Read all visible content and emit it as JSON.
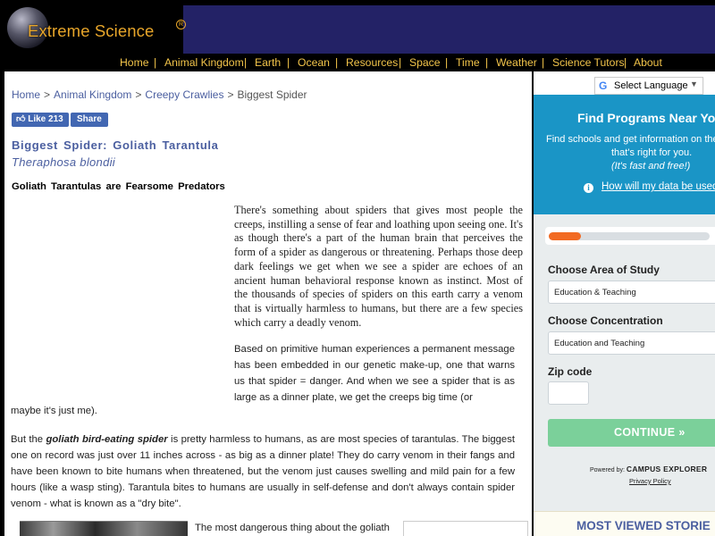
{
  "site": {
    "logo_text": "Extreme Science",
    "logo_mark": "R"
  },
  "nav": [
    "Home",
    "Animal Kingdom",
    "Earth",
    "Ocean",
    "Resources",
    "Space",
    "Time",
    "Weather",
    "Science Tutors",
    "About"
  ],
  "breadcrumb": {
    "items": [
      "Home",
      "Animal Kingdom",
      "Creepy Crawlies",
      "Biggest Spider"
    ],
    "separator": ">"
  },
  "social": {
    "like_label": "Like 213",
    "share_label": "Share"
  },
  "article": {
    "title": "Biggest Spider: Goliath Tarantula",
    "subtitle": "Theraphosa blondii",
    "section_heading": "Goliath Tarantulas are Fearsome Predators",
    "para1": "There's something about spiders that gives most people the creeps, instilling a sense of fear and loathing upon seeing one. It's as though there's a part of the human brain that perceives the form of a spider as dangerous or threatening. Perhaps those deep dark feelings we get when we see a spider are echoes of an ancient human behavioral response known as instinct. Most of the thousands of species of spiders on this earth carry a venom that is virtually harmless to humans, but there are a few species which carry a deadly venom.",
    "para2_a": "Based on primitive human experiences a permanent message has been embedded in our genetic make-up, one that warns us that spider = danger. And when we see a spider that is as large as a dinner plate, we get the creeps big time (or",
    "para2_b": "maybe it's just me).",
    "para3_before": "But the ",
    "para3_bold": "goliath bird-eating spider",
    "para3_after": " is pretty harmless to humans, as are most species of tarantulas. The biggest one on record was just over 11 inches across - as big as a dinner plate! They do carry venom in their fangs and have been known to bite humans when threatened, but the venom just causes swelling and mild pain for a few hours (like a wasp sting). Tarantula bites to humans are usually in self-defense and don't always contain spider venom - what is known as a \"dry bite\".",
    "para4": "The most dangerous thing about the goliath"
  },
  "sidebar": {
    "language_label": "Select Language",
    "language_caret": "▼",
    "panel_title": "Find Programs Near Yo",
    "panel_desc": "Find schools and get information on the",
    "panel_desc2": "that's right for you.",
    "panel_note": "(It's fast and free!)",
    "info_link": "How will my data be used?",
    "progress_fraction": 0.2,
    "area_label": "Choose Area of Study",
    "area_value": "Education & Teaching",
    "concentration_label": "Choose Concentration",
    "concentration_value": "Education and Teaching",
    "zip_label": "Zip code",
    "continue_label": "CONTINUE »",
    "powered_prefix": "Powered by:",
    "powered_brand": "CAMPUS EXPLORER",
    "privacy_label": "Privacy Policy",
    "most_viewed_title": "MOST VIEWED STORIE"
  }
}
